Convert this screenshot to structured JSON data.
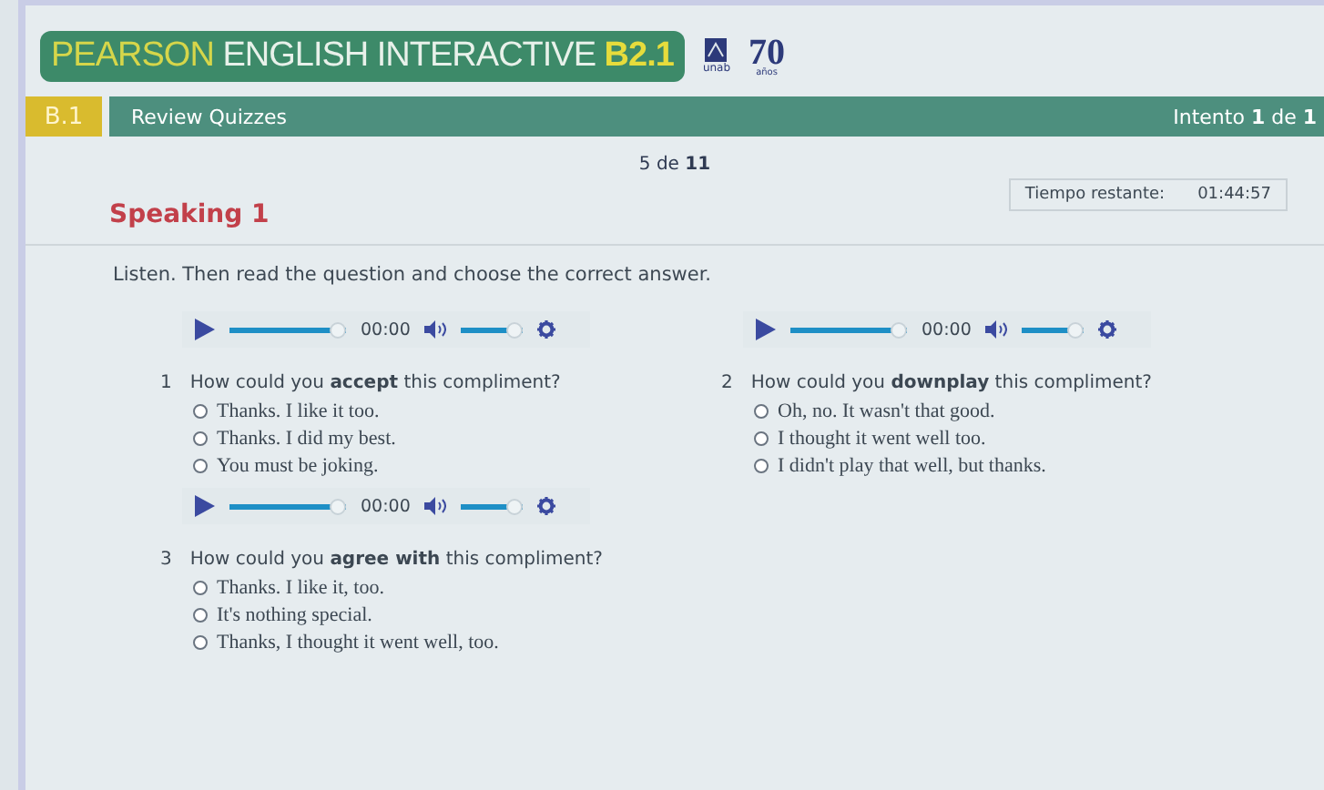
{
  "header": {
    "logo_parts": [
      {
        "text": "PEARSON",
        "kind": "accent"
      },
      {
        "text": " ENGLISH INTERACTIVE ",
        "kind": "plain"
      },
      {
        "text": "B2.1",
        "kind": "strong"
      }
    ],
    "unab_logo": {
      "label": "unab"
    },
    "anniversary": {
      "number": "70",
      "label": "años"
    }
  },
  "course_bar": {
    "code": "B.1",
    "title": "Review Quizzes",
    "attempt": "Intento **1** de **1**"
  },
  "progress": {
    "position": "5 de",
    "total": "11"
  },
  "section_title": "Speaking 1",
  "timer": {
    "label": "Tiempo restante:",
    "value": "01:44:57"
  },
  "instruction": "Listen. Then read the question and choose the correct answer.",
  "items": [
    {
      "player": {
        "time": "00:00",
        "level": 1,
        "volume": {
          "level": 1
        }
      },
      "number": "1",
      "question": "How could you **accept** this compliment?",
      "options": [
        {
          "label": "Thanks. I like it too.",
          "selected": false
        },
        {
          "label": "Thanks. I did my best.",
          "selected": false
        },
        {
          "label": "You must be joking.",
          "selected": false
        }
      ]
    },
    {
      "player": {
        "time": "00:00",
        "level": 1,
        "volume": {
          "level": 1
        }
      },
      "number": "2",
      "question": "How could you **downplay** this compliment?",
      "options": [
        {
          "label": "Oh, no. It wasn't that good.",
          "selected": false
        },
        {
          "label": "I thought it went well too.",
          "selected": false
        },
        {
          "label": "I didn't play that well, but thanks.",
          "selected": false
        }
      ]
    },
    {
      "player": {
        "time": "00:00",
        "level": 1,
        "volume": {
          "level": 1
        }
      },
      "number": "3",
      "question": "How could you **agree with** this compliment?",
      "options": [
        {
          "label": "Thanks. I like it, too.",
          "selected": false
        },
        {
          "label": "It's nothing special.",
          "selected": false
        },
        {
          "label": "Thanks, I thought it went well, too.",
          "selected": false
        }
      ]
    }
  ]
}
